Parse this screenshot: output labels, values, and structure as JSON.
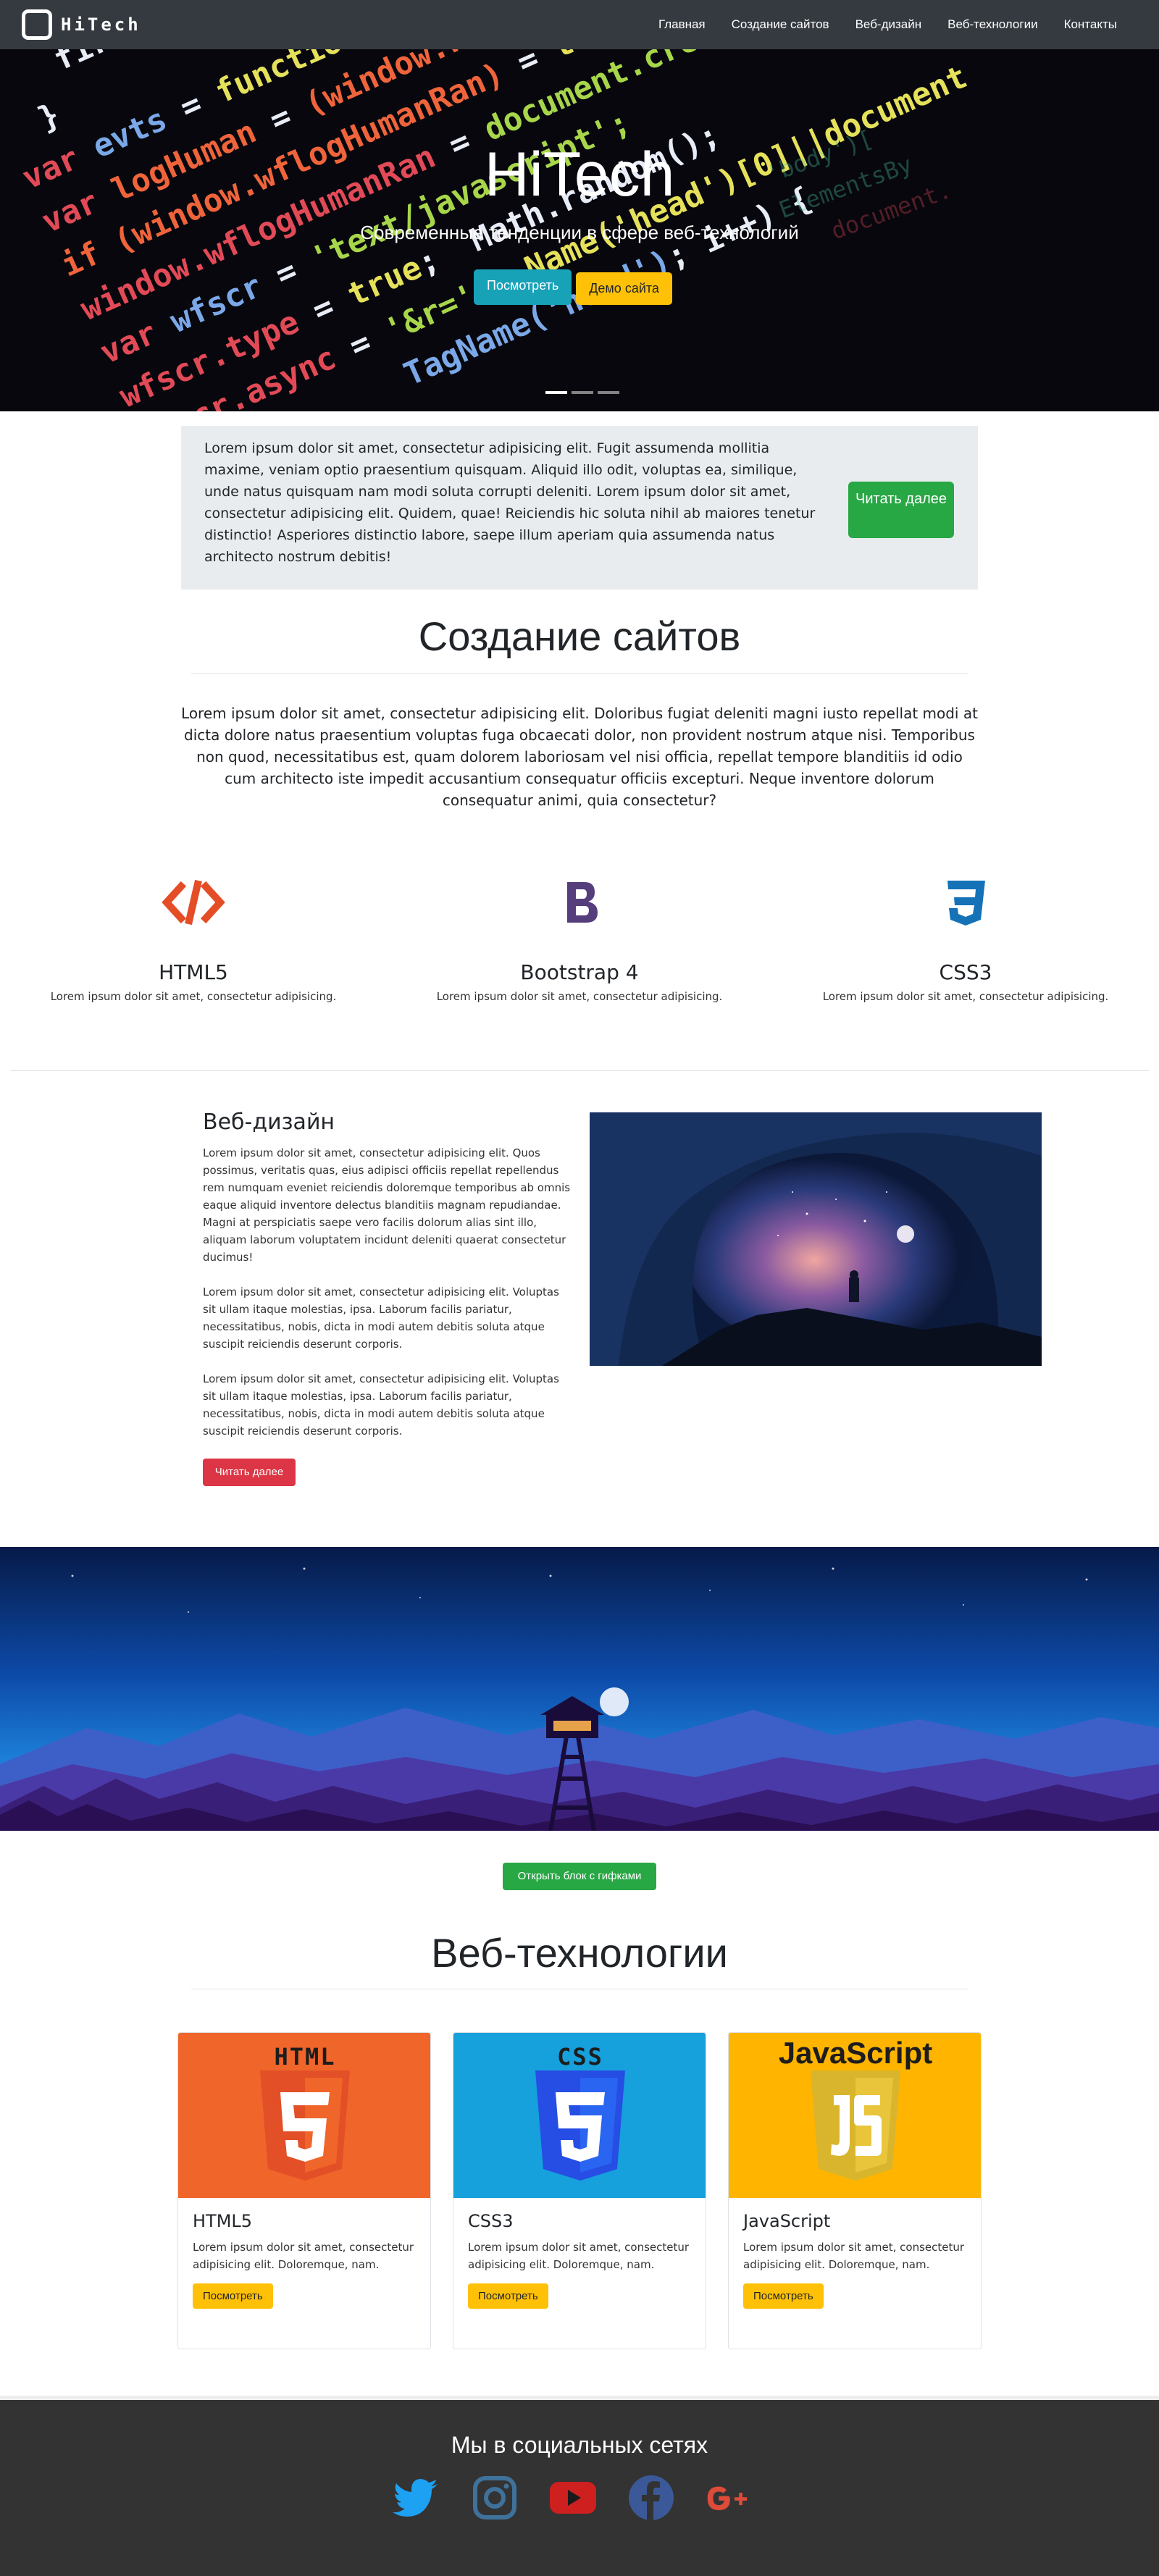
{
  "navbar": {
    "brand": "HiTech",
    "links": [
      "Главная",
      "Создание сайтов",
      "Веб-дизайн",
      "Веб-технологии",
      "Контакты"
    ]
  },
  "hero": {
    "title": "HiTech",
    "subtitle": "Современные тенденции в сфере веб-технологий",
    "btn_view": "Посмотреть",
    "btn_demo": "Демо сайта",
    "indicators": 3,
    "active_indicator": 1
  },
  "jumbotron": {
    "text": "Lorem ipsum dolor sit amet, consectetur adipisicing elit. Fugit assumenda mollitia maxime, veniam optio praesentium quisquam. Aliquid illo odit, voluptas ea, similique, unde natus quisquam nam modi soluta corrupti deleniti. Lorem ipsum dolor sit amet, consectetur adipisicing elit. Quidem, quae! Reiciendis hic soluta nihil ab maiores tenetur distinctio! Asperiores distinctio labore, saepe illum aperiam quia assumenda natus architecto nostrum debitis!",
    "button": "Читать далее"
  },
  "sites": {
    "title": "Создание сайтов",
    "lead": "Lorem ipsum dolor sit amet, consectetur adipisicing elit. Doloribus fugiat deleniti magni iusto repellat modi at dicta dolore natus praesentium voluptas fuga obcaecati dolor, non provident nostrum atque nisi. Temporibus non quod, necessitatibus est, quam dolorem laboriosam vel nisi officia, repellat tempore blanditiis id odio cum architecto iste impedit accusantium consequatur officiis excepturi. Neque inventore dolorum consequatur animi, quia consectetur?",
    "features": [
      {
        "title": "HTML5",
        "desc": "Lorem ipsum dolor sit amet, consectetur adipisicing.",
        "icon": "code-icon",
        "color": "#e44d26"
      },
      {
        "title": "Bootstrap 4",
        "desc": "Lorem ipsum dolor sit amet, consectetur adipisicing.",
        "icon": "bootstrap-icon",
        "color": "#563d7c"
      },
      {
        "title": "CSS3",
        "desc": "Lorem ipsum dolor sit amet, consectetur adipisicing.",
        "icon": "css3-icon",
        "color": "#1572b6"
      }
    ]
  },
  "webdesign": {
    "title": "Веб-дизайн",
    "p1": "Lorem ipsum dolor sit amet, consectetur adipisicing elit. Quos possimus, veritatis quas, eius adipisci officiis repellat repellendus rem numquam eveniet reiciendis doloremque temporibus ab omnis eaque aliquid inventore delectus blanditiis magnam repudiandae. Magni at perspiciatis saepe vero facilis dolorum alias sint illo, aliquam laborum voluptatem incidunt deleniti quaerat consectetur ducimus!",
    "p2": "Lorem ipsum dolor sit amet, consectetur adipisicing elit. Voluptas sit ullam itaque molestias, ipsa. Laborum facilis pariatur, necessitatibus, nobis, dicta in modi autem debitis soluta atque suscipit reiciendis deserunt corporis.",
    "p3": "Lorem ipsum dolor sit amet, consectetur adipisicing elit. Voluptas sit ullam itaque molestias, ipsa. Laborum facilis pariatur, necessitatibus, nobis, dicta in modi autem debitis soluta atque suscipit reiciendis deserunt corporis.",
    "button": "Читать далее"
  },
  "gif_button": "Открыть блок с гифками",
  "webtech": {
    "title": "Веб-технологии",
    "cards": [
      {
        "img_label": "HTML",
        "title": "HTML5",
        "text": "Lorem ipsum dolor sit amet, consectetur adipisicing elit. Doloremque, nam.",
        "button": "Посмотреть",
        "bg": "#ef652a",
        "shield": "#e34f26"
      },
      {
        "img_label": "CSS",
        "title": "CSS3",
        "text": "Lorem ipsum dolor sit amet, consectetur adipisicing elit. Doloremque, nam.",
        "button": "Посмотреть",
        "bg": "#16a0dc",
        "shield": "#264de4"
      },
      {
        "img_label": "JavaScript",
        "title": "JavaScript",
        "text": "Lorem ipsum dolor sit amet, consectetur adipisicing elit. Doloremque, nam.",
        "button": "Посмотреть",
        "bg": "#ffb400",
        "shield": "#d9b52e"
      }
    ]
  },
  "footer": {
    "title": "Мы в социальных сетях",
    "socials": [
      {
        "name": "twitter-icon",
        "color": "#1da1f2"
      },
      {
        "name": "instagram-icon",
        "color": "#3f729b"
      },
      {
        "name": "youtube-icon",
        "color": "#cd201f"
      },
      {
        "name": "facebook-icon",
        "color": "#3b5998"
      },
      {
        "name": "google-plus-icon",
        "color": "#dd4b39"
      }
    ]
  }
}
